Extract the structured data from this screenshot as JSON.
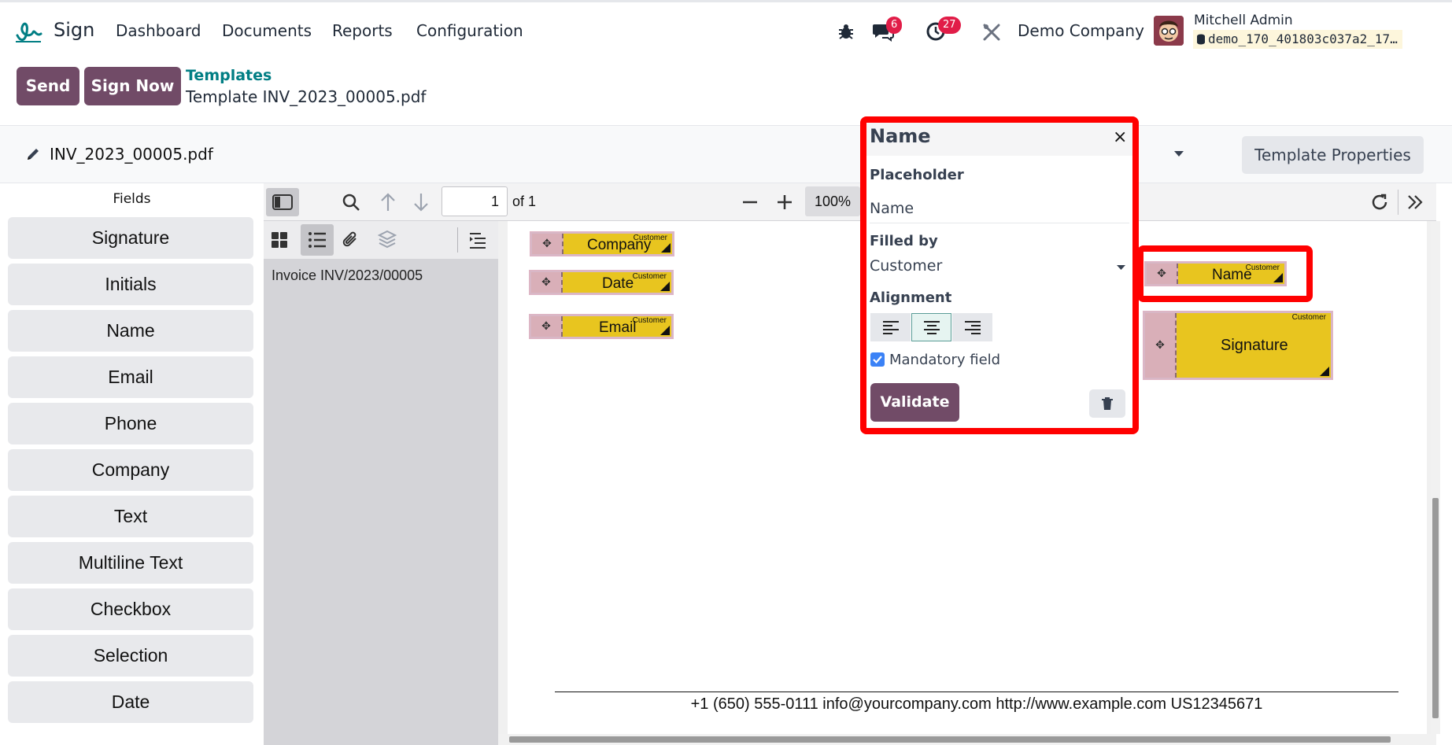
{
  "navbar": {
    "app_name": "Sign",
    "menu": [
      "Dashboard",
      "Documents",
      "Reports",
      "Configuration"
    ],
    "messages_count": "6",
    "activities_count": "27",
    "company": "Demo Company",
    "user_name": "Mitchell Admin",
    "database": "demo_170_401803c037a2_17…"
  },
  "control_panel": {
    "send_label": "Send",
    "sign_now_label": "Sign Now",
    "breadcrumb_parent": "Templates",
    "breadcrumb_current": "Template INV_2023_00005.pdf"
  },
  "document_bar": {
    "filename": "INV_2023_00005.pdf",
    "template_properties_label": "Template Properties"
  },
  "fields_panel": {
    "title": "Fields",
    "items": [
      "Signature",
      "Initials",
      "Name",
      "Email",
      "Phone",
      "Company",
      "Text",
      "Multiline Text",
      "Checkbox",
      "Selection",
      "Date"
    ]
  },
  "viewer": {
    "page_number": "1",
    "page_total": "of 1",
    "zoom": "100%",
    "outline_item": "Invoice INV/2023/00005"
  },
  "pdf_page": {
    "sign_items": [
      {
        "label": "Company",
        "responsible": "Customer"
      },
      {
        "label": "Date",
        "responsible": "Customer"
      },
      {
        "label": "Email",
        "responsible": "Customer"
      },
      {
        "label": "Name",
        "responsible": "Customer"
      },
      {
        "label": "Signature",
        "responsible": "Customer"
      }
    ],
    "footer": "+1 (650) 555-0111 info@yourcompany.com http://www.example.com US12345671"
  },
  "popover": {
    "title": "Name",
    "close_label": "×",
    "placeholder_label": "Placeholder",
    "placeholder_value": "Name",
    "filled_by_label": "Filled by",
    "filled_by_value": "Customer",
    "alignment_label": "Alignment",
    "alignment_selected": "center",
    "mandatory_label": "Mandatory field",
    "mandatory_checked": true,
    "validate_label": "Validate"
  },
  "colors": {
    "brand": "#714b67",
    "teal_link": "#017e84",
    "field_yellow": "#e8c51f",
    "highlight_red": "#ff0000",
    "badge_red": "#e11d48"
  }
}
